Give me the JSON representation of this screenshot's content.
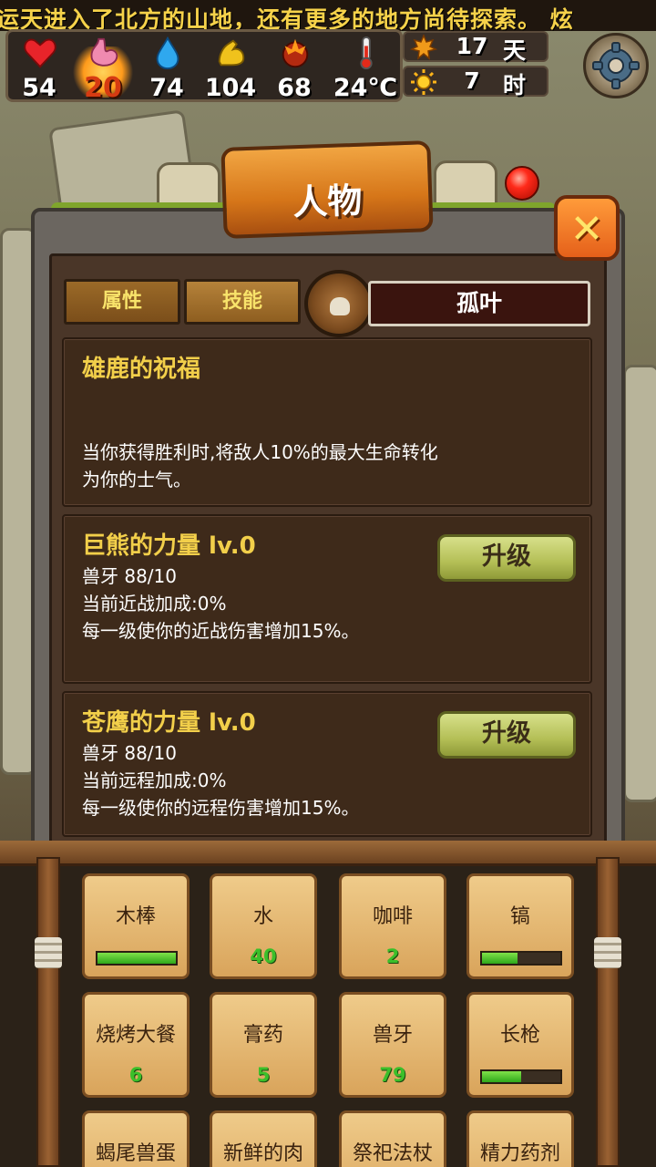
{
  "ticker": "运天进入了北方的山地，还有更多的地方尚待探索。   炫",
  "stats": [
    {
      "name": "health",
      "value": "54"
    },
    {
      "name": "hunger",
      "value": "20"
    },
    {
      "name": "water",
      "value": "74"
    },
    {
      "name": "strength",
      "value": "104"
    },
    {
      "name": "morale",
      "value": "68"
    },
    {
      "name": "temperature",
      "value": "24℃"
    }
  ],
  "time": {
    "day_value": "17",
    "day_unit": "天",
    "hour_value": "7",
    "hour_unit": "时"
  },
  "panel": {
    "title": "人物",
    "close": "✕",
    "tabs": [
      "属性",
      "技能"
    ],
    "character_name": "孤叶"
  },
  "skills": {
    "passive": {
      "title": "雄鹿的祝福",
      "desc1": "当你获得胜利时,将敌人10%的最大生命转化",
      "desc2": "为你的士气。"
    },
    "bear": {
      "title": "巨熊的力量 lv.0",
      "cost": "兽牙 88/10",
      "bonus": "当前近战加成:0%",
      "desc": "每一级使你的近战伤害增加15%。",
      "button": "升级"
    },
    "eagle": {
      "title": "苍鹰的力量 lv.0",
      "cost": "兽牙 88/10",
      "bonus": "当前远程加成:0%",
      "desc": "每一级使你的远程伤害增加15%。",
      "button": "升级"
    }
  },
  "inventory": [
    {
      "name": "木棒",
      "durability": 1.0
    },
    {
      "name": "水",
      "count": "40"
    },
    {
      "name": "咖啡",
      "count": "2"
    },
    {
      "name": "镐",
      "durability": 0.45
    },
    {
      "name": "烧烤大餐",
      "count": "6"
    },
    {
      "name": "膏药",
      "count": "5"
    },
    {
      "name": "兽牙",
      "count": "79"
    },
    {
      "name": "长枪",
      "durability": 0.5
    },
    {
      "name": "蝎尾兽蛋"
    },
    {
      "name": "新鲜的肉"
    },
    {
      "name": "祭祀法杖"
    },
    {
      "name": "精力药剂"
    }
  ]
}
